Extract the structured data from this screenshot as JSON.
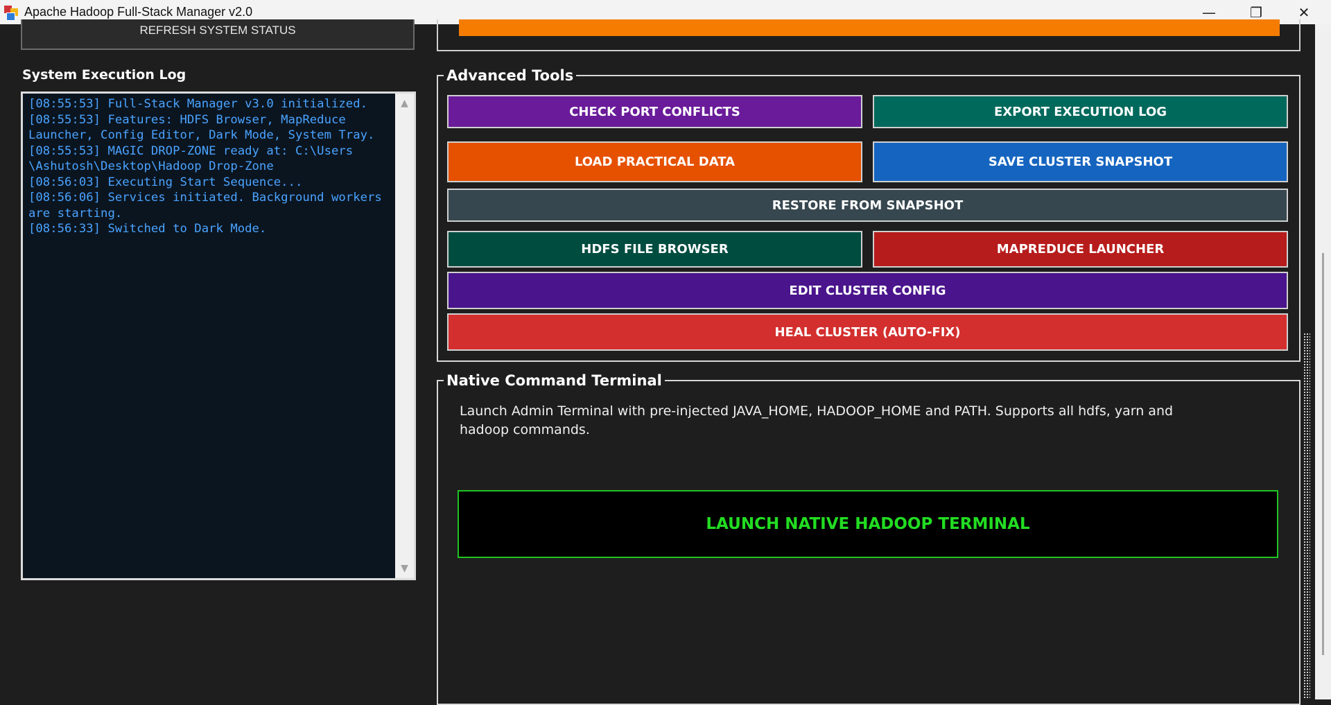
{
  "window": {
    "title": "Apache Hadoop Full-Stack Manager v2.0",
    "controls": {
      "minimize": "—",
      "maximize": "❐",
      "close": "✕"
    }
  },
  "left": {
    "refresh_label": "REFRESH SYSTEM STATUS",
    "log_heading": "System Execution Log",
    "log_lines": [
      "[08:55:53] Full-Stack Manager v3.0 initialized.",
      "[08:55:53] Features: HDFS Browser, MapReduce",
      "Launcher, Config Editor, Dark Mode, System Tray.",
      "[08:55:53] MAGIC DROP-ZONE ready at: C:\\Users",
      "\\Ashutosh\\Desktop\\Hadoop Drop-Zone",
      "[08:56:03] Executing Start Sequence...",
      "[08:56:06] Services initiated. Background workers",
      "are starting.",
      "[08:56:33] Switched to Dark Mode."
    ],
    "scroll_up": "▲",
    "scroll_down": "▼"
  },
  "advanced": {
    "title": "Advanced Tools",
    "buttons": {
      "check_ports": "CHECK PORT CONFLICTS",
      "export_log": "EXPORT EXECUTION LOG",
      "load_data": "LOAD PRACTICAL DATA",
      "save_snapshot": "SAVE CLUSTER SNAPSHOT",
      "restore_snapshot": "RESTORE FROM SNAPSHOT",
      "hdfs_browser": "HDFS FILE BROWSER",
      "mapreduce": "MAPREDUCE LAUNCHER",
      "edit_config": "EDIT CLUSTER CONFIG",
      "heal": "HEAL CLUSTER (AUTO-FIX)"
    }
  },
  "terminal": {
    "title": "Native Command Terminal",
    "description": "Launch Admin Terminal with pre-injected JAVA_HOME, HADOOP_HOME and PATH. Supports all hdfs, yarn and hadoop commands.",
    "launch_label": "LAUNCH NATIVE HADOOP TERMINAL"
  },
  "colors": {
    "orange_bar": "#f57c00",
    "purple": "#6a1b9a",
    "teal": "#00695c",
    "orange": "#e65100",
    "blue": "#1565c0",
    "slate": "#37474f",
    "dark_green": "#004d40",
    "red": "#b71c1c",
    "deep_purple": "#4a148c",
    "bright_red": "#d32f2f",
    "terminal_green": "#22dd22"
  }
}
